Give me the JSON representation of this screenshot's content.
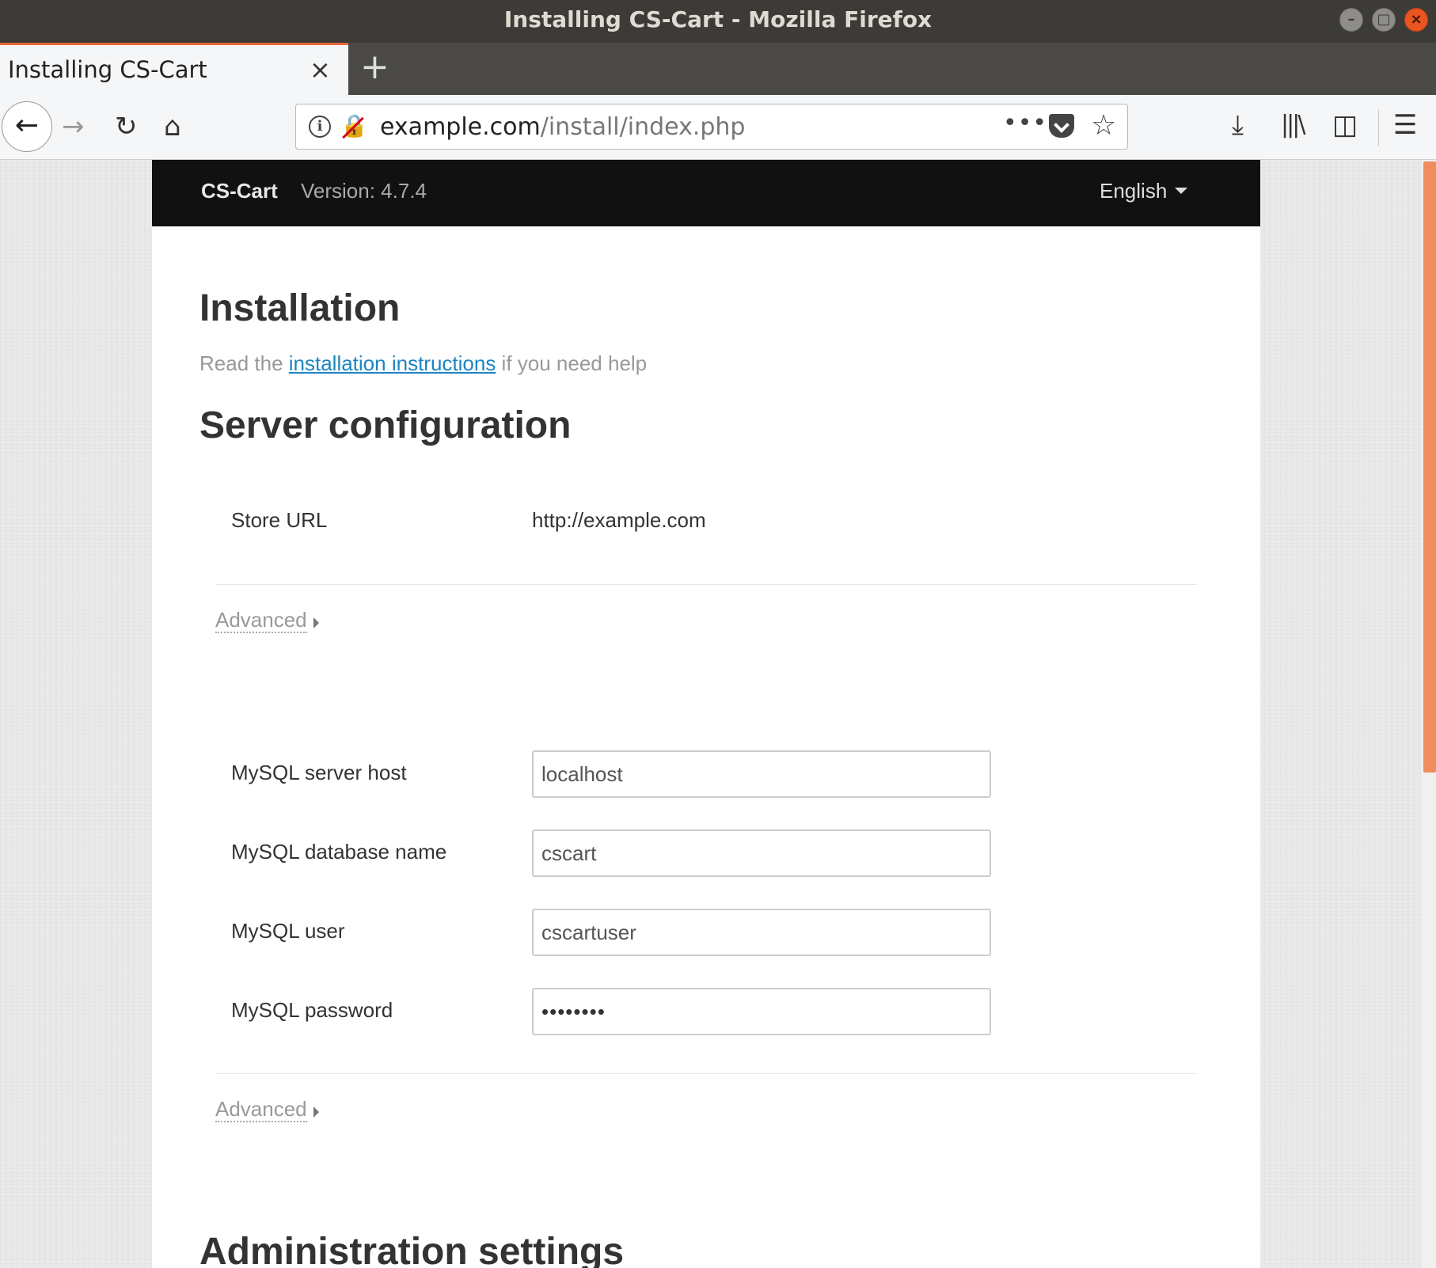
{
  "window": {
    "title": "Installing CS-Cart - Mozilla Firefox"
  },
  "tab": {
    "title": "Installing CS-Cart",
    "close": "×",
    "new_tab": "+"
  },
  "urlbar": {
    "domain": "example.com",
    "path": "/install/index.php",
    "more": "•••"
  },
  "header": {
    "brand": "CS-Cart",
    "version": "Version: 4.7.4",
    "language": "English"
  },
  "content": {
    "title": "Installation",
    "help_prefix": "Read the ",
    "help_link": "installation instructions",
    "help_suffix": " if you need help",
    "server_section": "Server configuration",
    "store_url_label": "Store URL",
    "store_url_value": "http://example.com",
    "advanced_1": "Advanced",
    "mysql_host_label": "MySQL server host",
    "mysql_host_value": "localhost",
    "mysql_db_label": "MySQL database name",
    "mysql_db_value": "cscart",
    "mysql_user_label": "MySQL user",
    "mysql_user_value": "cscartuser",
    "mysql_password_label": "MySQL password",
    "mysql_password_value": "••••••••",
    "advanced_2": "Advanced",
    "admin_section": "Administration settings"
  },
  "colors": {
    "accent_link": "#1b85c2",
    "tab_accent": "#e8663a",
    "header_bg": "#111111",
    "scrollbar": "#ef8e5c"
  }
}
